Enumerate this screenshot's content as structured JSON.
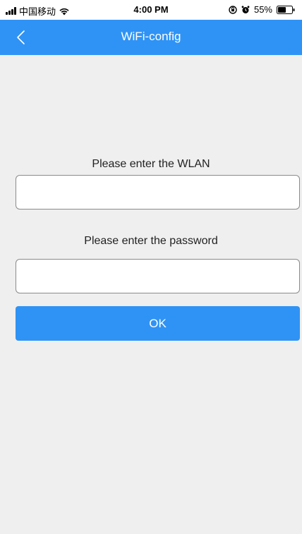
{
  "status_bar": {
    "carrier": "中国移动",
    "time": "4:00 PM",
    "battery": "55%"
  },
  "nav": {
    "title": "WiFi-config",
    "back_icon": "chevron-left-icon"
  },
  "form": {
    "wlan_label": "Please enter the WLAN",
    "wlan_value": "",
    "password_label": "Please enter the password",
    "password_value": "",
    "ok_label": "OK"
  },
  "colors": {
    "accent": "#2f93f5",
    "background": "#efefef"
  }
}
